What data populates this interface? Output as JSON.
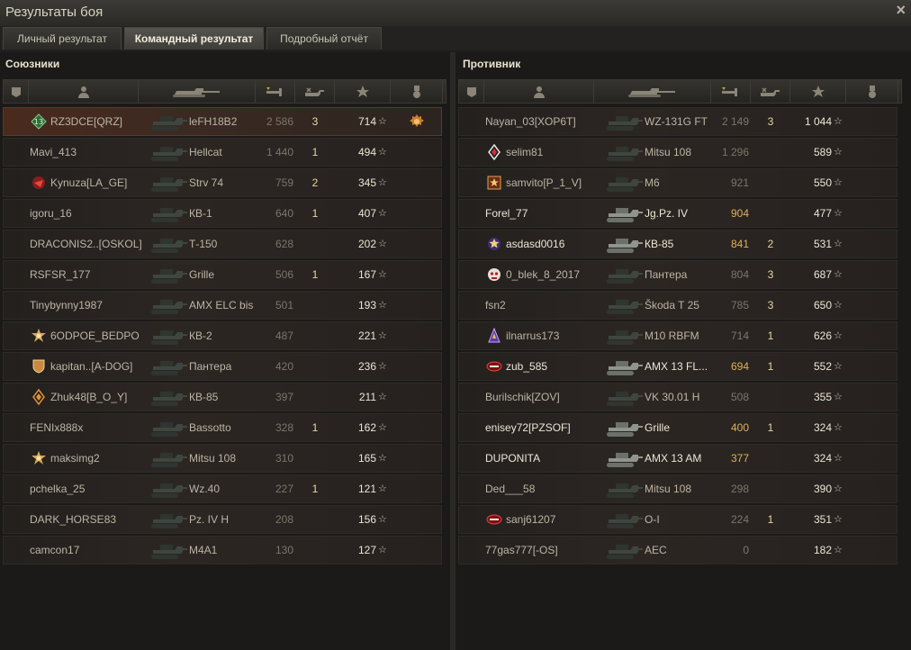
{
  "window": {
    "title": "Результаты боя",
    "close": "×"
  },
  "tabs": [
    {
      "label": "Личный результат"
    },
    {
      "label": "Командный результат"
    },
    {
      "label": "Подробный отчёт"
    }
  ],
  "allies": {
    "title": "Союзники",
    "rows": [
      {
        "name": "RZ3DCE[QRZ]",
        "vehicle": "leFH18B2",
        "xp": "2 586",
        "frags": "3",
        "damage": "714",
        "badge": "green-diamond-badge",
        "medal": true,
        "me": true
      },
      {
        "name": "Mavi_413",
        "vehicle": "Hellcat",
        "xp": "1 440",
        "frags": "1",
        "damage": "494"
      },
      {
        "name": "Kynuza[LA_GE]",
        "vehicle": "Strv 74",
        "xp": "759",
        "frags": "2",
        "damage": "345",
        "badge": "red-clan-badge"
      },
      {
        "name": "igoru_16",
        "vehicle": "КВ-1",
        "xp": "640",
        "frags": "1",
        "damage": "407"
      },
      {
        "name": "DRACONIS2..[OSKOL]",
        "vehicle": "Т-150",
        "xp": "628",
        "frags": "",
        "damage": "202"
      },
      {
        "name": "RSFSR_177",
        "vehicle": "Grille",
        "xp": "506",
        "frags": "1",
        "damage": "167"
      },
      {
        "name": "Tinybynny1987",
        "vehicle": "AMX ELC bis",
        "xp": "501",
        "frags": "",
        "damage": "193"
      },
      {
        "name": "6ODPOE_BEDPO",
        "vehicle": "КВ-2",
        "xp": "487",
        "frags": "",
        "damage": "221",
        "badge": "gold-star-badge"
      },
      {
        "name": "kapitan..[A-DOG]",
        "vehicle": "Пантера",
        "xp": "420",
        "frags": "",
        "damage": "236",
        "badge": "shield-clan-badge"
      },
      {
        "name": "Zhuk48[B_O_Y]",
        "vehicle": "КВ-85",
        "xp": "397",
        "frags": "",
        "damage": "211",
        "badge": "orange-diamond-badge"
      },
      {
        "name": "FENIx888x",
        "vehicle": "Bassotto",
        "xp": "328",
        "frags": "1",
        "damage": "162"
      },
      {
        "name": "maksimg2",
        "vehicle": "Mitsu 108",
        "xp": "310",
        "frags": "",
        "damage": "165",
        "badge": "gold-star-badge"
      },
      {
        "name": "pchelka_25",
        "vehicle": "Wz.40",
        "xp": "227",
        "frags": "1",
        "damage": "121"
      },
      {
        "name": "DARK_HORSE83",
        "vehicle": "Pz. IV H",
        "xp": "208",
        "frags": "",
        "damage": "156"
      },
      {
        "name": "camcon17",
        "vehicle": "M4A1",
        "xp": "130",
        "frags": "",
        "damage": "127"
      }
    ]
  },
  "enemies": {
    "title": "Противник",
    "rows": [
      {
        "name": "Nayan_03[XOP6T]",
        "vehicle": "WZ-131G FT",
        "xp": "2 149",
        "frags": "3",
        "damage": "1 044"
      },
      {
        "name": "selim81",
        "vehicle": "Mitsu 108",
        "xp": "1 296",
        "frags": "",
        "damage": "589",
        "badge": "white-diamond-badge"
      },
      {
        "name": "samvito[P_1_V]",
        "vehicle": "M6",
        "xp": "921",
        "frags": "",
        "damage": "550",
        "badge": "gold-shield-badge"
      },
      {
        "name": "Forel_77",
        "vehicle": "Jg.Pz. IV",
        "xp": "904",
        "frags": "",
        "damage": "477",
        "bright": true,
        "xphi": true
      },
      {
        "name": "asdasd0016",
        "vehicle": "КВ-85",
        "xp": "841",
        "frags": "2",
        "damage": "531",
        "bright": true,
        "xphi": true,
        "badge": "purple-star-badge"
      },
      {
        "name": "0_blek_8_2017",
        "vehicle": "Пантера",
        "xp": "804",
        "frags": "3",
        "damage": "687",
        "badge": "red-skull-badge"
      },
      {
        "name": "fsn2",
        "vehicle": "Škoda T 25",
        "xp": "785",
        "frags": "3",
        "damage": "650"
      },
      {
        "name": "ilnarrus173",
        "vehicle": "M10 RBFM",
        "xp": "714",
        "frags": "1",
        "damage": "626",
        "badge": "purple-flag-badge"
      },
      {
        "name": "zub_585",
        "vehicle": "AMX 13 FL...",
        "xp": "694",
        "frags": "1",
        "damage": "552",
        "bright": true,
        "xphi": true,
        "badge": "red-wing-badge"
      },
      {
        "name": "Burilschik[ZOV]",
        "vehicle": "VK 30.01 H",
        "xp": "508",
        "frags": "",
        "damage": "355"
      },
      {
        "name": "enisey72[PZSOF]",
        "vehicle": "Grille",
        "xp": "400",
        "frags": "1",
        "damage": "324",
        "bright": true,
        "xphi": true
      },
      {
        "name": "DUPONITA",
        "vehicle": "AMX 13 AM",
        "xp": "377",
        "frags": "",
        "damage": "324",
        "bright": true,
        "xphi": true
      },
      {
        "name": "Ded___58",
        "vehicle": "Mitsu 108",
        "xp": "298",
        "frags": "",
        "damage": "390"
      },
      {
        "name": "sanj61207",
        "vehicle": "O-I",
        "xp": "224",
        "frags": "1",
        "damage": "351",
        "badge": "red-wing-badge"
      },
      {
        "name": "77gas777[-OS]",
        "vehicle": "AEC",
        "xp": "0",
        "frags": "",
        "damage": "182"
      }
    ]
  },
  "columns": [
    "platoon-icon",
    "player-icon",
    "vehicle-icon",
    "xp-icon",
    "frags-icon",
    "damage-icon",
    "medal-icon"
  ],
  "colors": {
    "accent_xp": "#e0b15a",
    "row_me": "#4a2a1d",
    "text": "#cfc8b6"
  }
}
